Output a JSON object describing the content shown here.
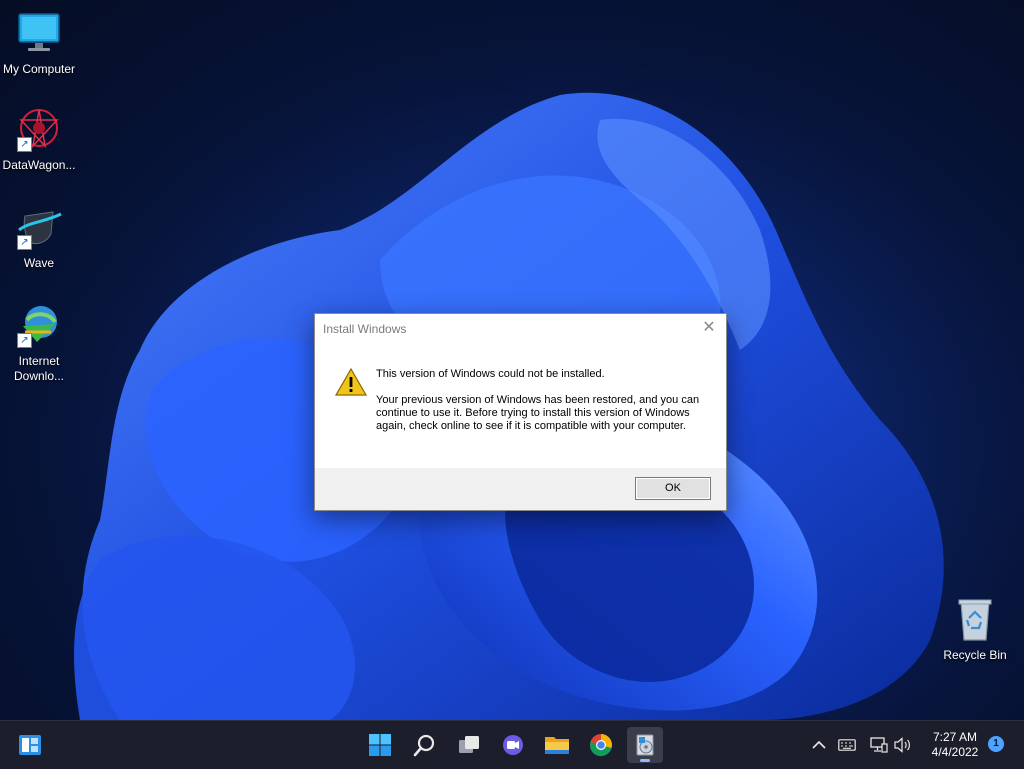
{
  "desktop": {
    "icons": [
      {
        "label": "My Computer",
        "icon": "monitor-icon",
        "shortcut": false
      },
      {
        "label": "DataWagon...",
        "icon": "datawagon-icon",
        "shortcut": true
      },
      {
        "label": "Wave",
        "icon": "wave-icon",
        "shortcut": true
      },
      {
        "label": "Internet\nDownlo...",
        "icon": "internet-download-manager-icon",
        "shortcut": true
      },
      {
        "label": "Recycle Bin",
        "icon": "recycle-bin-icon",
        "shortcut": false
      }
    ]
  },
  "dialog": {
    "title": "Install Windows",
    "close_label": "✕",
    "icon": "warning-icon",
    "headline": "This version of Windows could not be installed.",
    "message": "Your previous version of Windows has been restored, and you can continue to use it.  Before trying to install this version of Windows again, check online to see if it is compatible with your computer.",
    "ok_label": "OK"
  },
  "taskbar": {
    "left_icon": "widgets-icon",
    "center_items": [
      {
        "icon": "start-icon",
        "active": false
      },
      {
        "icon": "search-icon",
        "active": false
      },
      {
        "icon": "task-view-icon",
        "active": false
      },
      {
        "icon": "chat-icon",
        "active": false
      },
      {
        "icon": "file-explorer-icon",
        "active": false
      },
      {
        "icon": "chrome-icon",
        "active": false
      },
      {
        "icon": "setup-icon",
        "active": true
      }
    ],
    "tray": [
      "chevron-up-icon",
      "keyboard-icon",
      "network-icon",
      "volume-icon"
    ],
    "clock": {
      "time": "7:27 AM",
      "date": "4/4/2022"
    },
    "notification_count": "1"
  },
  "colors": {
    "accent": "#2f6bff",
    "taskbar": "#1c1f2b",
    "dialog_footer": "#f0f0f0"
  }
}
